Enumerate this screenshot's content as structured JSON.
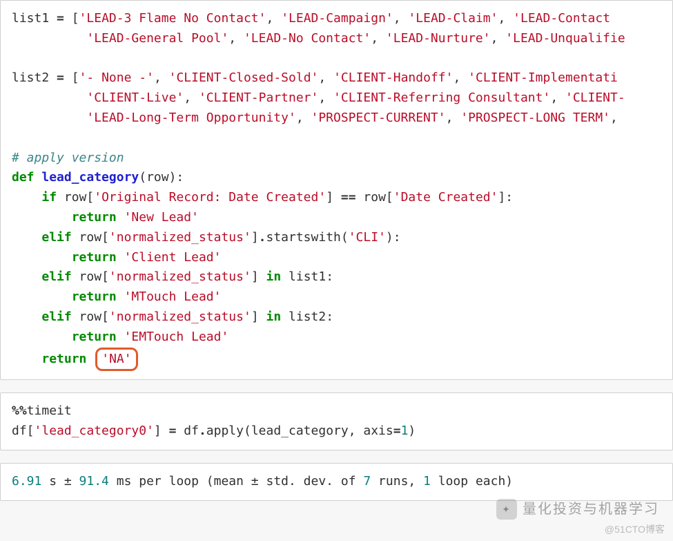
{
  "cell1": {
    "l1_a": "list1 ",
    "l1_eq": "=",
    "l1_b": " [",
    "l1_s1": "'LEAD-3 Flame No Contact'",
    "l1_c1": ", ",
    "l1_s2": "'LEAD-Campaign'",
    "l1_c2": ", ",
    "l1_s3": "'LEAD-Claim'",
    "l1_c3": ", ",
    "l1_s4": "'LEAD-Contact ",
    "l2_pad": "          ",
    "l2_s1": "'LEAD-General Pool'",
    "l2_c1": ", ",
    "l2_s2": "'LEAD-No Contact'",
    "l2_c2": ", ",
    "l2_s3": "'LEAD-Nurture'",
    "l2_c3": ", ",
    "l2_s4": "'LEAD-Unqualifie",
    "blank1": " ",
    "l3_a": "list2 ",
    "l3_eq": "=",
    "l3_b": " [",
    "l3_s1": "'- None -'",
    "l3_c1": ", ",
    "l3_s2": "'CLIENT-Closed-Sold'",
    "l3_c2": ", ",
    "l3_s3": "'CLIENT-Handoff'",
    "l3_c3": ", ",
    "l3_s4": "'CLIENT-Implementati",
    "l4_pad": "          ",
    "l4_s1": "'CLIENT-Live'",
    "l4_c1": ", ",
    "l4_s2": "'CLIENT-Partner'",
    "l4_c2": ", ",
    "l4_s3": "'CLIENT-Referring Consultant'",
    "l4_c3": ", ",
    "l4_s4": "'CLIENT-",
    "l5_pad": "          ",
    "l5_s1": "'LEAD-Long-Term Opportunity'",
    "l5_c1": ", ",
    "l5_s2": "'PROSPECT-CURRENT'",
    "l5_c2": ", ",
    "l5_s3": "'PROSPECT-LONG TERM'",
    "l5_c3": ", ",
    "blank2": " ",
    "cmt": "# apply version",
    "def_kw": "def",
    "def_sp": " ",
    "def_nm": "lead_category",
    "def_rest": "(row):",
    "if_pad": "    ",
    "if_kw": "if",
    "if_a": " row[",
    "if_s1": "'Original Record: Date Created'",
    "if_b": "] ",
    "if_eq": "==",
    "if_c": " row[",
    "if_s2": "'Date Created'",
    "if_d": "]:",
    "r1_pad": "        ",
    "r1_kw": "return",
    "r1_sp": " ",
    "r1_s": "'New Lead'",
    "e1_pad": "    ",
    "e1_kw": "elif",
    "e1_a": " row[",
    "e1_s": "'normalized_status'",
    "e1_b": "]",
    "e1_c": ".",
    "e1_m": "startswith(",
    "e1_arg": "'CLI'",
    "e1_end": "):",
    "r2_pad": "        ",
    "r2_kw": "return",
    "r2_sp": " ",
    "r2_s": "'Client Lead'",
    "e2_pad": "    ",
    "e2_kw": "elif",
    "e2_a": " row[",
    "e2_s": "'normalized_status'",
    "e2_b": "] ",
    "e2_in": "in",
    "e2_c": " list1:",
    "r3_pad": "        ",
    "r3_kw": "return",
    "r3_sp": " ",
    "r3_s": "'MTouch Lead'",
    "e3_pad": "    ",
    "e3_kw": "elif",
    "e3_a": " row[",
    "e3_s": "'normalized_status'",
    "e3_b": "] ",
    "e3_in": "in",
    "e3_c": " list2:",
    "r4_pad": "        ",
    "r4_kw": "return",
    "r4_sp": " ",
    "r4_s": "'EMTouch Lead'",
    "r5_pad": "    ",
    "r5_kw": "return",
    "r5_sp": " ",
    "r5_s": "'NA'"
  },
  "cell2": {
    "magic_pct": "%%",
    "magic_name": "timeit",
    "l2_a": "df[",
    "l2_s1": "'lead_category0'",
    "l2_b": "] ",
    "l2_eq": "=",
    "l2_c": " df",
    "l2_dot": ".",
    "l2_m": "apply(lead_category, axis",
    "l2_eq2": "=",
    "l2_n": "1",
    "l2_end": ")"
  },
  "cell3": {
    "v1": "6.91",
    "t1": " s ± ",
    "v2": "91.4",
    "t2": " ms per loop (mean ± std. dev. of ",
    "v3": "7",
    "t3": " runs, ",
    "v4": "1",
    "t4": " loop each)"
  },
  "watermark": {
    "text": "量化投资与机器学习",
    "sub": "@51CTO博客"
  }
}
